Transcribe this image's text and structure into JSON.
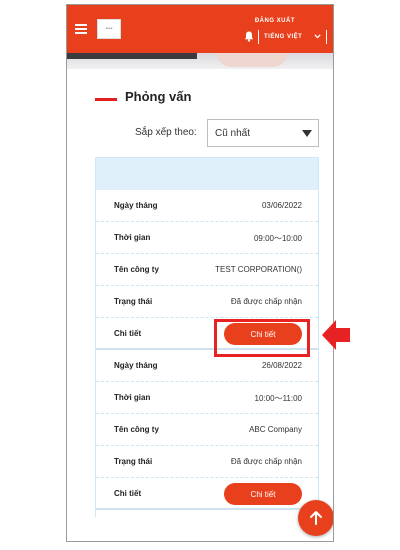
{
  "header": {
    "logo_text": "••••",
    "logout_label": "ĐĂNG XUẤT",
    "language_label": "TIẾNG VIỆT"
  },
  "page": {
    "title": "Phỏng vấn"
  },
  "sort": {
    "label": "Sắp xếp theo:",
    "selected": "Cũ nhất"
  },
  "interviews": [
    {
      "rows": [
        {
          "label": "Ngày tháng",
          "value": "03/06/2022"
        },
        {
          "label": "Thời gian",
          "value": "09:00〜10:00"
        },
        {
          "label": "Tên công ty",
          "value": "TEST CORPORATION()"
        },
        {
          "label": "Trạng thái",
          "value": "Đã được chấp nhận"
        }
      ],
      "detail_label": "Chi tiết",
      "detail_button": "Chi tiết"
    },
    {
      "rows": [
        {
          "label": "Ngày tháng",
          "value": "26/08/2022"
        },
        {
          "label": "Thời gian",
          "value": "10:00〜11:00"
        },
        {
          "label": "Tên công ty",
          "value": "ABC Company"
        },
        {
          "label": "Trạng thái",
          "value": "Đã được chấp nhận"
        }
      ],
      "detail_label": "Chi tiết",
      "detail_button": "Chi tiết"
    }
  ],
  "colors": {
    "brand": "#e8401c",
    "list_header": "#dff0fb",
    "annotation": "#e82222"
  },
  "icons": [
    "menu-icon",
    "bell-icon",
    "chevron-down-icon",
    "caret-down-icon",
    "arrow-up-icon",
    "arrow-left-icon"
  ]
}
